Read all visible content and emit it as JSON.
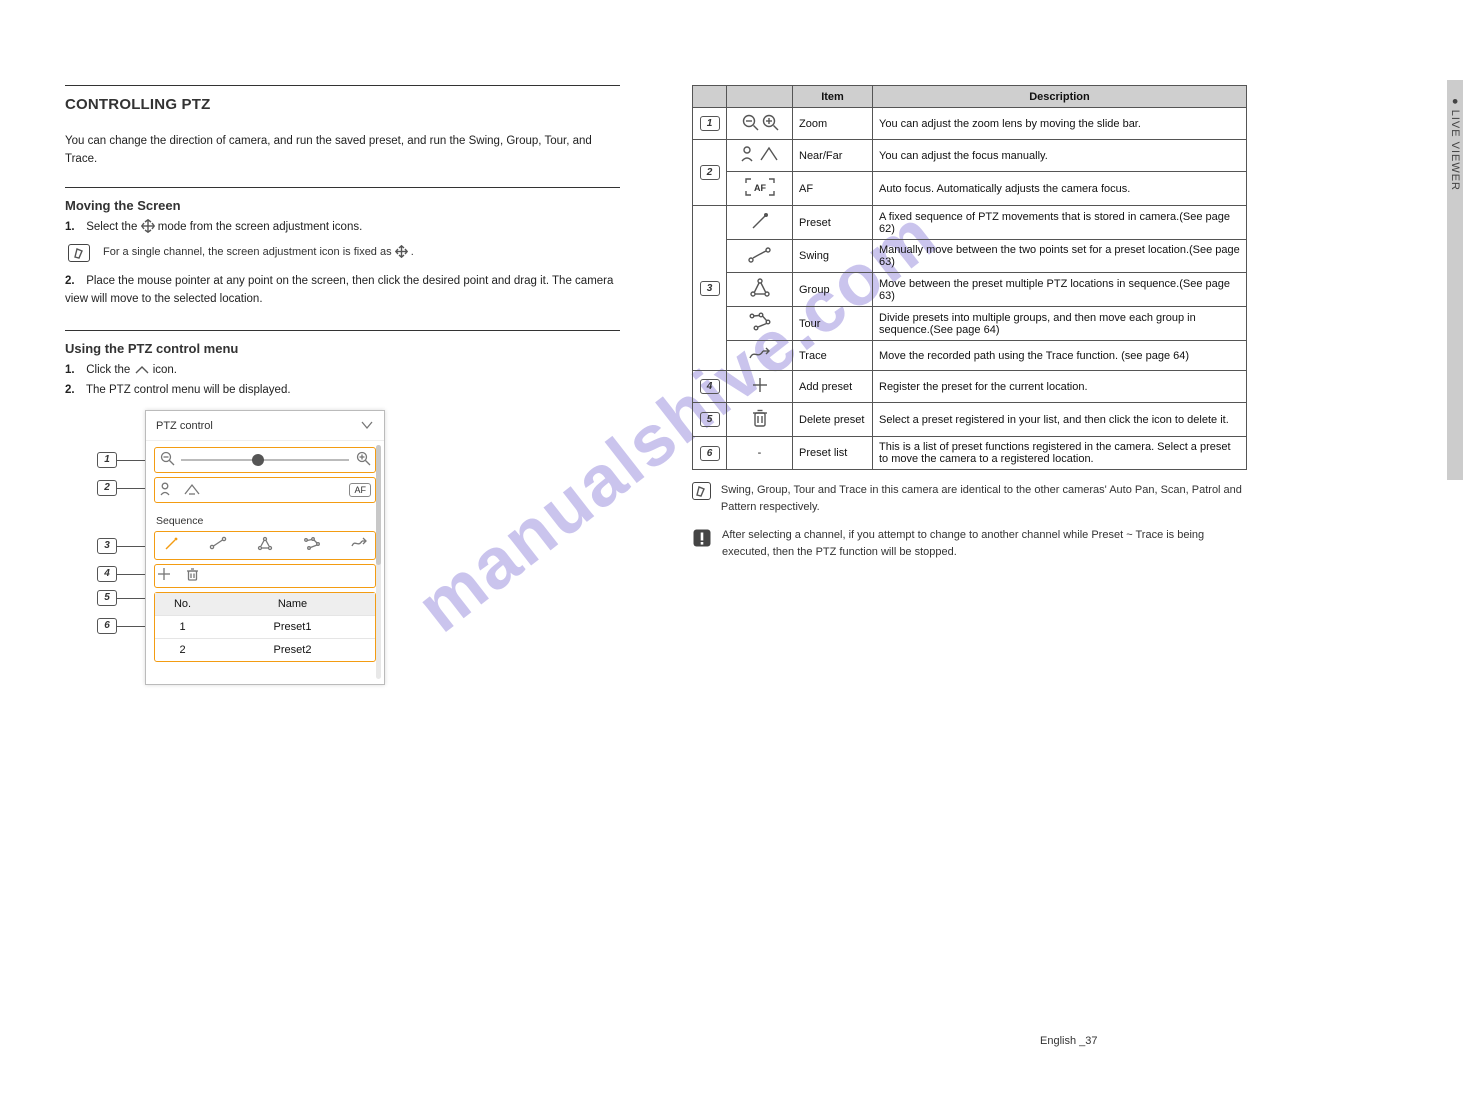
{
  "page": {
    "footer": "English _37",
    "side_tab_label": "●   LIVE VIEWER"
  },
  "left": {
    "ptz_heading": "CONTROLLING PTZ",
    "ptz_intro": "You can change the direction of camera, and run the saved preset, and run the Swing, Group, Tour, and Trace.",
    "move_heading": "Moving the Screen",
    "move1_pre": "Select the ",
    "move1_post": " mode from the screen adjustment icons.",
    "note_pre": "For a single channel, the screen adjustment icon is fixed as ",
    "note_post": ".",
    "move2": "Place the mouse pointer at any point on the screen, then click the desired point and drag it. The camera view will move to the selected location.",
    "menu_heading": "Using the PTZ control menu",
    "menu_step1_pre": "Click the ",
    "menu_step1_post": " icon.",
    "menu_step2": "The PTZ control menu will be displayed.",
    "panel": {
      "title": "PTZ control",
      "seq_title": "Sequence",
      "table": {
        "hdr_no": "No.",
        "hdr_name": "Name",
        "rows": [
          {
            "no": "1",
            "name": "Preset1"
          },
          {
            "no": "2",
            "name": "Preset2"
          }
        ]
      }
    }
  },
  "right": {
    "table": {
      "hdr_item": "Item",
      "hdr_desc": "Description",
      "rows": [
        {
          "idx": "1",
          "item": "Zoom",
          "desc": "You can adjust the zoom lens by moving the slide bar."
        },
        {
          "idx": "2",
          "item": "Near/Far",
          "desc": "You can adjust the focus manually."
        },
        {
          "idx": "2b",
          "item": "AF",
          "desc": "Auto focus. Automatically adjusts the camera focus."
        },
        {
          "idx": "3",
          "item": "Preset",
          "desc": "A fixed sequence of PTZ movements that is stored in camera.(See page 62)"
        },
        {
          "idx": "3b",
          "item": "Swing",
          "desc": "Manually move between the two points set for a preset location.(See page 63)"
        },
        {
          "idx": "3c",
          "item": "Group",
          "desc": "Move between the preset multiple PTZ locations in sequence.(See page 63)"
        },
        {
          "idx": "3d",
          "item": "Tour",
          "desc": "Divide presets into multiple groups, and then move each group in sequence.(See page 64)"
        },
        {
          "idx": "3e",
          "item": "Trace",
          "desc": "Move the recorded path using the Trace function. (see page 64)"
        },
        {
          "idx": "4",
          "item": "Add preset",
          "desc": "Register the preset for the current location."
        },
        {
          "idx": "5",
          "item": "Delete preset",
          "desc": "Select a preset registered in your list, and then click the icon to delete it."
        },
        {
          "idx": "6",
          "item": "Preset list",
          "desc": "This is a list of preset functions registered in the camera. Select a preset to move the camera to a registered location."
        }
      ]
    },
    "note_m": "Swing, Group, Tour and Trace in this camera are identical to the other cameras' Auto Pan, Scan, Patrol and Pattern respectively.",
    "note_j": "After selecting a channel, if you attempt to change to another channel while Preset ~ Trace is being executed, then the PTZ function will be stopped."
  },
  "watermark": "manualshive.com"
}
